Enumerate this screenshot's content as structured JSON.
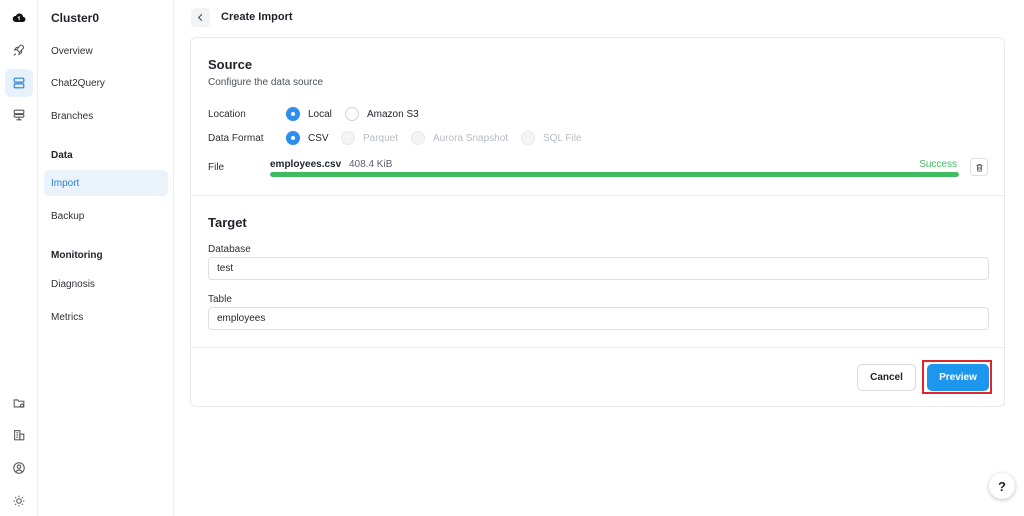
{
  "sidebar": {
    "cluster_name": "Cluster0",
    "items": [
      {
        "label": "Overview"
      },
      {
        "label": "Chat2Query"
      },
      {
        "label": "Branches"
      }
    ],
    "data_section": "Data",
    "data_items": [
      {
        "label": "Import"
      },
      {
        "label": "Backup"
      }
    ],
    "monitoring_section": "Monitoring",
    "monitoring_items": [
      {
        "label": "Diagnosis"
      },
      {
        "label": "Metrics"
      }
    ]
  },
  "header": {
    "title": "Create Import"
  },
  "source": {
    "title": "Source",
    "description": "Configure the data source",
    "location_label": "Location",
    "location_options": [
      "Local",
      "Amazon S3"
    ],
    "location_selected": "Local",
    "format_label": "Data Format",
    "format_options": [
      "CSV",
      "Parquet",
      "Aurora Snapshot",
      "SQL File"
    ],
    "format_selected": "CSV",
    "file_label": "File",
    "file_name": "employees.csv",
    "file_size": "408.4 KiB",
    "upload_status": "Success",
    "upload_progress": 1.0
  },
  "target": {
    "title": "Target",
    "database_label": "Database",
    "database_value": "test",
    "table_label": "Table",
    "table_value": "employees"
  },
  "actions": {
    "cancel_label": "Cancel",
    "preview_label": "Preview"
  },
  "help_label": "?",
  "colors": {
    "accent": "#1d97ee",
    "success": "#3fbb60",
    "highlight": "#e0262a"
  }
}
